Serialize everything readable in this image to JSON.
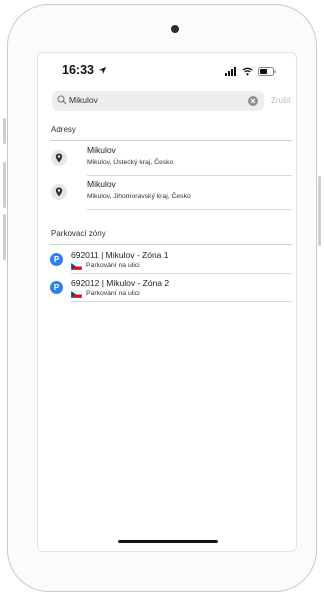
{
  "status_bar": {
    "time": "16:33"
  },
  "search": {
    "query": "Mikulov",
    "cancel_label": "Zrušit"
  },
  "sections": {
    "addresses": {
      "header": "Adresy",
      "items": [
        {
          "title": "Mikulov",
          "subtitle": "Mikulov, Ústecký kraj, Česko"
        },
        {
          "title": "Mikulov",
          "subtitle": "Mikulov, Jihomoravský kraj, Česko"
        }
      ]
    },
    "zones": {
      "header": "Parkovací zóny",
      "badge": "P",
      "items": [
        {
          "title": "692011 | Mikulov - Zóna 1",
          "subtitle": "Parkování na ulici"
        },
        {
          "title": "692012 | Mikulov - Zóna 2",
          "subtitle": "Parkování na ulici"
        }
      ]
    }
  },
  "colors": {
    "accent": "#2f80ed",
    "cancel": "#bdbdbd",
    "search_bg": "#eeeeef"
  },
  "icons": [
    "location-arrow-icon",
    "signal-icon",
    "wifi-icon",
    "battery-icon",
    "search-icon",
    "clear-icon",
    "pin-icon",
    "czech-flag-icon"
  ]
}
